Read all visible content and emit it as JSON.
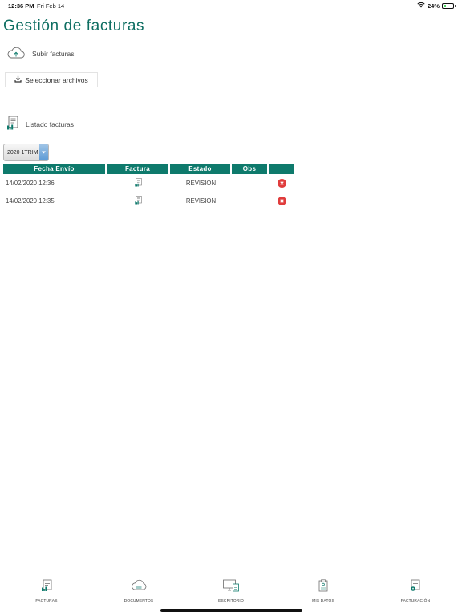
{
  "status_bar": {
    "time": "12:36 PM",
    "date": "Fri Feb 14",
    "battery": "24%",
    "battery_level": 0.24
  },
  "page_title": "Gestión de facturas",
  "upload": {
    "label": "Subir facturas",
    "button_label": "Seleccionar archivos"
  },
  "listado": {
    "label": "Listado facturas"
  },
  "period_select": {
    "selected": "2020 1TRIM"
  },
  "table": {
    "headers": [
      "Fecha Envío",
      "Factura",
      "Estado",
      "Obs",
      ""
    ],
    "rows": [
      {
        "fecha": "14/02/2020 12:36",
        "estado": "REVISION",
        "obs": ""
      },
      {
        "fecha": "14/02/2020 12:35",
        "estado": "REVISION",
        "obs": ""
      }
    ]
  },
  "bottom_nav": {
    "items": [
      {
        "label": "FACTURAS",
        "icon": "invoice-icon"
      },
      {
        "label": "DOCUMENTOS",
        "icon": "cloud-icon"
      },
      {
        "label": "ESCRITORIO",
        "icon": "desktop-icon"
      },
      {
        "label": "MIS DATOS",
        "icon": "clipboard-icon"
      },
      {
        "label": "FACTURACIÓN",
        "icon": "billing-icon"
      }
    ]
  },
  "colors": {
    "brand": "#0e7a6c",
    "title": "#0e6e62",
    "delete": "#e03c3c"
  }
}
